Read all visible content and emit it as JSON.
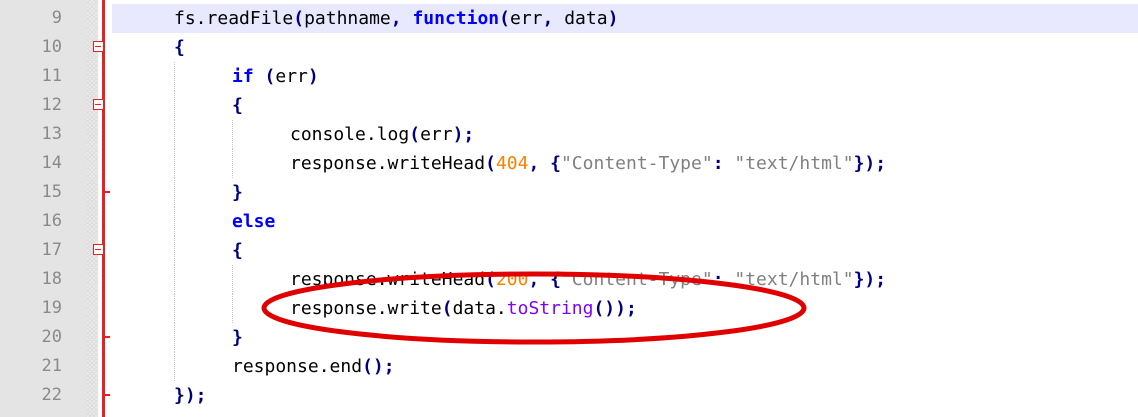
{
  "editor": {
    "colors": {
      "keyword": "#0000ff",
      "operator": "#000080",
      "number": "#ff8000",
      "string": "#808080",
      "method": "#8000ff",
      "fold_markers": "#e82020",
      "annotation_ellipse": "#e00000",
      "current_line": "#e8e8ff"
    },
    "lines": [
      {
        "number": "9",
        "indent": 1,
        "fold": "none",
        "current": true,
        "tokens": [
          [
            "pl",
            "fs."
          ],
          [
            "pl",
            "readFile"
          ],
          [
            "op",
            "("
          ],
          [
            "pl",
            "pathname"
          ],
          [
            "op",
            ", "
          ],
          [
            "kw",
            "function"
          ],
          [
            "op",
            "("
          ],
          [
            "pl",
            "err"
          ],
          [
            "op",
            ", "
          ],
          [
            "pl",
            "data"
          ],
          [
            "op",
            ")"
          ]
        ]
      },
      {
        "number": "10",
        "indent": 1,
        "fold": "open",
        "tokens": [
          [
            "op",
            "{"
          ]
        ]
      },
      {
        "number": "11",
        "indent": 2,
        "fold": "none",
        "tokens": [
          [
            "kw",
            "if"
          ],
          [
            "pl",
            " "
          ],
          [
            "op",
            "("
          ],
          [
            "pl",
            "err"
          ],
          [
            "op",
            ")"
          ]
        ]
      },
      {
        "number": "12",
        "indent": 2,
        "fold": "open",
        "tokens": [
          [
            "op",
            "{"
          ]
        ]
      },
      {
        "number": "13",
        "indent": 3,
        "fold": "none",
        "tokens": [
          [
            "pl",
            "console."
          ],
          [
            "pl",
            "log"
          ],
          [
            "op",
            "("
          ],
          [
            "pl",
            "err"
          ],
          [
            "op",
            ");"
          ]
        ]
      },
      {
        "number": "14",
        "indent": 3,
        "fold": "none",
        "tokens": [
          [
            "pl",
            "response."
          ],
          [
            "pl",
            "writeHead"
          ],
          [
            "op",
            "("
          ],
          [
            "num",
            "404"
          ],
          [
            "op",
            ", {"
          ],
          [
            "str",
            "\"Content-Type\""
          ],
          [
            "op",
            ": "
          ],
          [
            "str",
            "\"text/html\""
          ],
          [
            "op",
            "});"
          ]
        ]
      },
      {
        "number": "15",
        "indent": 2,
        "fold": "end",
        "tokens": [
          [
            "op",
            "}"
          ]
        ]
      },
      {
        "number": "16",
        "indent": 2,
        "fold": "none",
        "tokens": [
          [
            "kw",
            "else"
          ]
        ]
      },
      {
        "number": "17",
        "indent": 2,
        "fold": "open",
        "tokens": [
          [
            "op",
            "{"
          ]
        ]
      },
      {
        "number": "18",
        "indent": 3,
        "fold": "none",
        "tokens": [
          [
            "pl",
            "response."
          ],
          [
            "pl",
            "writeHead"
          ],
          [
            "op",
            "("
          ],
          [
            "num",
            "200"
          ],
          [
            "op",
            ", {"
          ],
          [
            "str",
            "\"Content-Type\""
          ],
          [
            "op",
            ": "
          ],
          [
            "str",
            "\"text/html\""
          ],
          [
            "op",
            "});"
          ]
        ]
      },
      {
        "number": "19",
        "indent": 3,
        "fold": "none",
        "tokens": [
          [
            "pl",
            "response."
          ],
          [
            "pl",
            "write"
          ],
          [
            "op",
            "("
          ],
          [
            "pl",
            "data."
          ],
          [
            "me",
            "toString"
          ],
          [
            "op",
            "());"
          ]
        ]
      },
      {
        "number": "20",
        "indent": 2,
        "fold": "end",
        "tokens": [
          [
            "op",
            "}"
          ]
        ]
      },
      {
        "number": "21",
        "indent": 2,
        "fold": "none",
        "tokens": [
          [
            "pl",
            "response."
          ],
          [
            "pl",
            "end"
          ],
          [
            "op",
            "();"
          ]
        ]
      },
      {
        "number": "22",
        "indent": 1,
        "fold": "end",
        "tokens": [
          [
            "op",
            "});"
          ]
        ]
      }
    ]
  }
}
